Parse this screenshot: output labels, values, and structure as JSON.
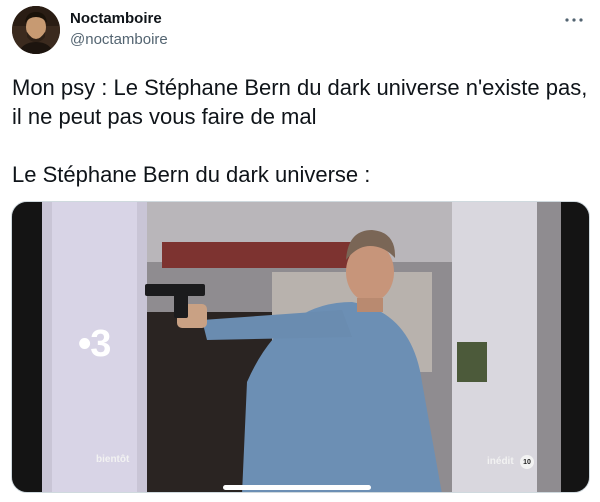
{
  "author": {
    "display_name": "Noctamboire",
    "handle": "@noctamboire",
    "avatar_icon": "avatar-portrait"
  },
  "menu": {
    "more_icon": "more-horizontal-icon"
  },
  "tweet": {
    "line1": "Mon psy : Le Stéphane Bern du dark universe n'existe pas, il ne peut pas vous faire de mal",
    "line2": "Le Stéphane Bern du dark universe :"
  },
  "media": {
    "channel_logo": "•3",
    "soon_label": "bientôt",
    "inedit_label": "inédit",
    "rating_badge": "10"
  },
  "colors": {
    "text_primary": "#0f1419",
    "text_secondary": "#536471",
    "border": "#cfd9de"
  }
}
